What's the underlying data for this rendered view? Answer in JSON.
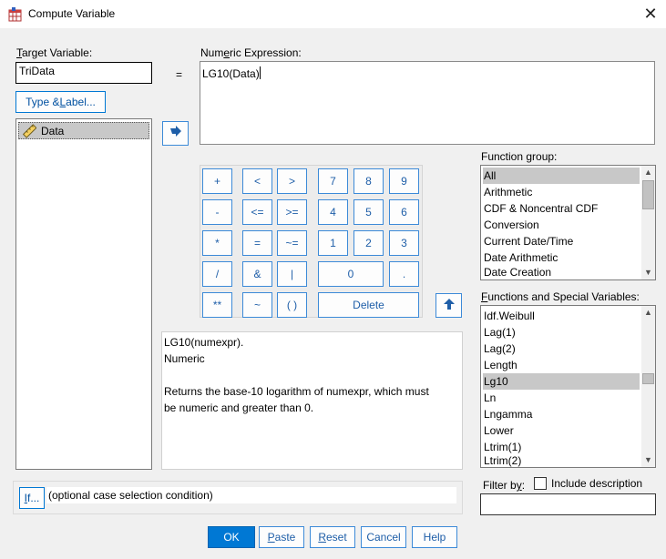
{
  "window": {
    "title": "Compute Variable",
    "close_glyph": "✕"
  },
  "target_variable": {
    "label_accel": "T",
    "label_rest": "arget Variable:",
    "value": "TriData",
    "type_label_accel": "L",
    "type_label_pre": "Type & ",
    "type_label_post": "abel..."
  },
  "equals_sign": "=",
  "numeric_expression": {
    "label_pre": "Num",
    "label_accel": "e",
    "label_post": "ric Expression:",
    "value": "LG10(Data)"
  },
  "variables_list": {
    "items": [
      {
        "label": "Data",
        "icon": "ruler-icon",
        "selected": true
      }
    ]
  },
  "calculator": {
    "keys": {
      "plus": "+",
      "lt": "<",
      "gt": ">",
      "seven": "7",
      "eight": "8",
      "nine": "9",
      "minus": "-",
      "le": "<=",
      "ge": ">=",
      "four": "4",
      "five": "5",
      "six": "6",
      "multiply": "*",
      "eq": "=",
      "ne": "~=",
      "one": "1",
      "two": "2",
      "three": "3",
      "divide": "/",
      "and": "&",
      "or": "|",
      "zero": "0",
      "dot": ".",
      "power": "**",
      "not": "~",
      "parens": "( )",
      "delete": "Delete"
    }
  },
  "description": {
    "line1": "LG10(numexpr).",
    "line2": "Numeric",
    "line3": "Returns the base-10 logarithm of numexpr, which must",
    "line4": "be numeric and greater than 0."
  },
  "function_group": {
    "label": "Function group:",
    "items": [
      "All",
      "Arithmetic",
      "CDF & Noncentral CDF",
      "Conversion",
      "Current Date/Time",
      "Date Arithmetic",
      "Date Creation"
    ],
    "selected_index": 0
  },
  "functions_list": {
    "label_accel": "F",
    "label_rest": "unctions and Special Variables:",
    "items": [
      "Idf.Weibull",
      "Lag(1)",
      "Lag(2)",
      "Length",
      "Lg10",
      "Ln",
      "Lngamma",
      "Lower",
      "Ltrim(1)",
      "Ltrim(2)"
    ],
    "selected_index": 4
  },
  "filter": {
    "label_pre": "Filter b",
    "label_accel": "y",
    "label_post": ":",
    "checkbox_label": "Include description",
    "checked": false,
    "value": ""
  },
  "if_section": {
    "button_accel": "I",
    "button_rest": "f...",
    "condition_text": "(optional case selection condition)"
  },
  "buttons": {
    "ok": "OK",
    "paste_accel": "P",
    "paste_rest": "aste",
    "reset_accel": "R",
    "reset_rest": "eset",
    "cancel": "Cancel",
    "help": "Help"
  },
  "colors": {
    "accent": "#0078d4",
    "selection": "#c8c8c8",
    "dialog_bg": "#f0f0f0"
  }
}
